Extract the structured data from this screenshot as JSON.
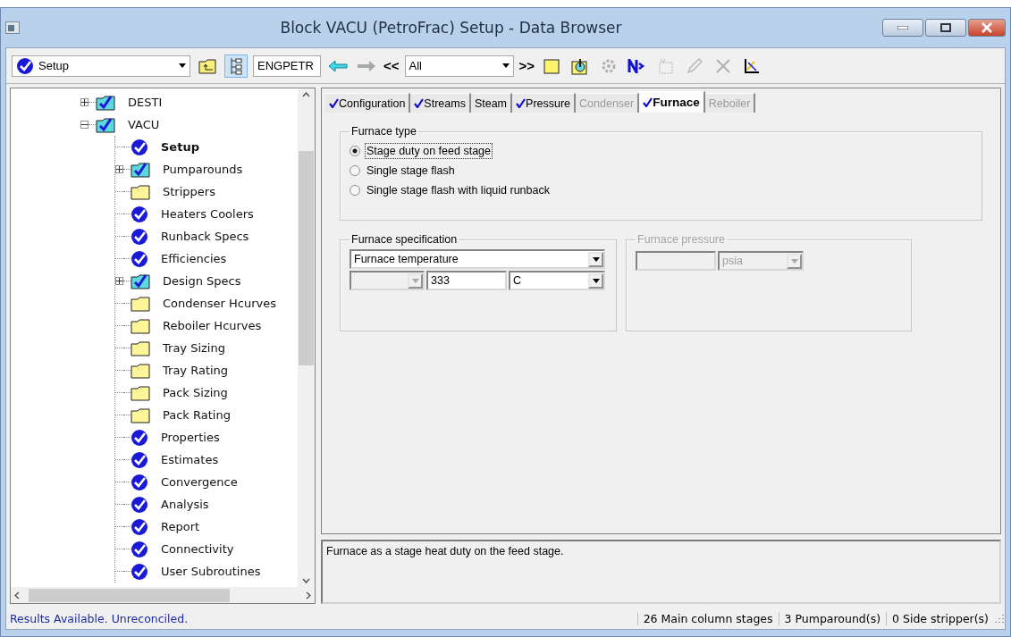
{
  "window": {
    "title": "Block VACU (PetroFrac) Setup - Data Browser"
  },
  "toolbar": {
    "form_select": "Setup",
    "units_select": "ENGPETR",
    "prev_label": "<<",
    "filter_select": "All",
    "next_label": ">>"
  },
  "tree": [
    {
      "label": "DESTI",
      "kind": "block",
      "expanded": false,
      "selected": false
    },
    {
      "label": "VACU",
      "kind": "block",
      "expanded": true,
      "selected": false,
      "children": [
        {
          "label": "Setup",
          "kind": "complete",
          "selected": true
        },
        {
          "label": "Pumparounds",
          "kind": "folder-complete",
          "expanded": false,
          "selected": false
        },
        {
          "label": "Strippers",
          "kind": "empty",
          "selected": false
        },
        {
          "label": "Heaters Coolers",
          "kind": "complete",
          "selected": false
        },
        {
          "label": "Runback Specs",
          "kind": "complete",
          "selected": false
        },
        {
          "label": "Efficiencies",
          "kind": "complete",
          "selected": false
        },
        {
          "label": "Design Specs",
          "kind": "folder-complete",
          "expanded": false,
          "selected": false
        },
        {
          "label": "Condenser Hcurves",
          "kind": "empty",
          "selected": false
        },
        {
          "label": "Reboiler Hcurves",
          "kind": "empty",
          "selected": false
        },
        {
          "label": "Tray Sizing",
          "kind": "empty",
          "selected": false
        },
        {
          "label": "Tray Rating",
          "kind": "empty",
          "selected": false
        },
        {
          "label": "Pack Sizing",
          "kind": "empty",
          "selected": false
        },
        {
          "label": "Pack Rating",
          "kind": "empty",
          "selected": false
        },
        {
          "label": "Properties",
          "kind": "complete",
          "selected": false
        },
        {
          "label": "Estimates",
          "kind": "complete",
          "selected": false
        },
        {
          "label": "Convergence",
          "kind": "complete",
          "selected": false
        },
        {
          "label": "Analysis",
          "kind": "complete",
          "selected": false
        },
        {
          "label": "Report",
          "kind": "complete",
          "selected": false
        },
        {
          "label": "Connectivity",
          "kind": "complete",
          "selected": false
        },
        {
          "label": "User Subroutines",
          "kind": "complete",
          "selected": false
        }
      ]
    }
  ],
  "tabs": [
    {
      "label": "Configuration",
      "checked": true,
      "disabled": false,
      "selected": false
    },
    {
      "label": "Streams",
      "checked": true,
      "disabled": false,
      "selected": false
    },
    {
      "label": "Steam",
      "checked": false,
      "disabled": false,
      "selected": false
    },
    {
      "label": "Pressure",
      "checked": true,
      "disabled": false,
      "selected": false
    },
    {
      "label": "Condenser",
      "checked": false,
      "disabled": true,
      "selected": false
    },
    {
      "label": "Furnace",
      "checked": true,
      "disabled": false,
      "selected": true
    },
    {
      "label": "Reboiler",
      "checked": false,
      "disabled": true,
      "selected": false
    }
  ],
  "furnace_type": {
    "title": "Furnace type",
    "options": [
      {
        "label": "Stage duty on feed stage",
        "selected": true
      },
      {
        "label": "Single stage flash",
        "selected": false
      },
      {
        "label": "Single stage flash with liquid runback",
        "selected": false
      }
    ]
  },
  "furnace_specification": {
    "title": "Furnace specification",
    "spec": "Furnace temperature",
    "value": "333",
    "unit": "C"
  },
  "furnace_pressure": {
    "title": "Furnace pressure",
    "unit": "psia",
    "disabled": true
  },
  "description": "Furnace as a stage heat duty on the feed stage.",
  "status_bar": {
    "message": "Results Available. Unreconciled.",
    "fields": [
      "26 Main column stages",
      "3 Pumparound(s)",
      "0 Side stripper(s)"
    ]
  }
}
